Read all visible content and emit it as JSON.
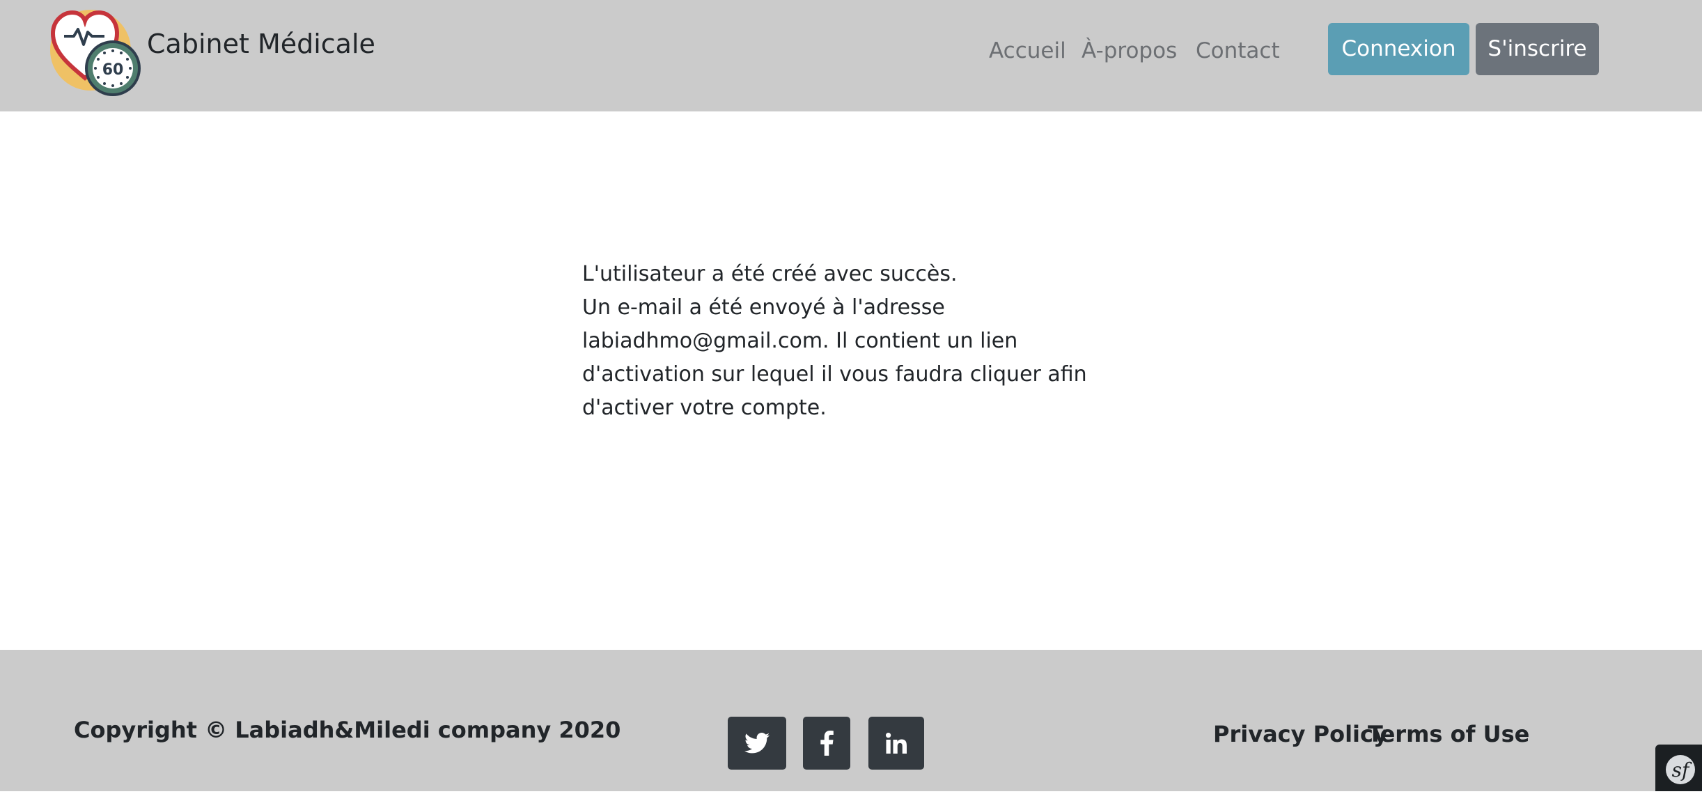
{
  "header": {
    "brand": "Cabinet Médicale",
    "nav": [
      {
        "label": "Accueil"
      },
      {
        "label": "À-propos"
      },
      {
        "label": "Contact"
      }
    ],
    "login_label": "Connexion",
    "signup_label": "S'inscrire",
    "logo_badge_number": "60"
  },
  "main": {
    "message_lines": [
      "L'utilisateur a été créé avec succès.",
      "Un e-mail a été envoyé à l'adresse",
      "labiadhmo@gmail.com. Il contient un lien",
      "d'activation sur lequel il vous faudra cliquer afin",
      "d'activer votre compte."
    ]
  },
  "footer": {
    "copyright": "Copyright © Labiadh&Miledi company 2020",
    "social": [
      {
        "icon": "twitter-icon"
      },
      {
        "icon": "facebook-icon"
      },
      {
        "icon": "linkedin-icon"
      }
    ],
    "links": [
      {
        "label": "Privacy Policy"
      },
      {
        "label": "Terms of Use"
      }
    ]
  },
  "toolbar": {
    "icon": "symfony-icon"
  },
  "colors": {
    "header_bg": "#cbcbcb",
    "login_button": "#5b9eb4",
    "signup_button": "#6c737b",
    "social_button": "#343a40"
  }
}
